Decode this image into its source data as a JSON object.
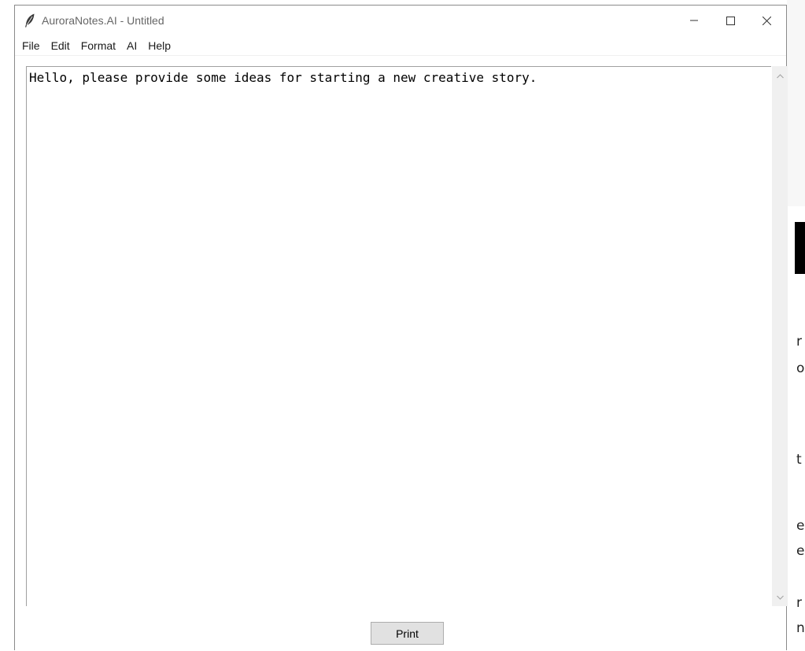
{
  "window": {
    "title": "AuroraNotes.AI - Untitled"
  },
  "menubar": {
    "items": [
      "File",
      "Edit",
      "Format",
      "AI",
      "Help"
    ]
  },
  "editor": {
    "content": "Hello, please provide some ideas for starting a new creative story."
  },
  "bottom": {
    "print_label": "Print"
  },
  "background_window": {
    "fragments": [
      "r",
      "o:",
      "t",
      "e",
      "e",
      "r",
      "n"
    ]
  },
  "icons": {
    "app": "feather-icon",
    "minimize": "minimize-icon",
    "maximize": "maximize-icon",
    "close": "close-icon",
    "scroll_up": "chevron-up-icon",
    "scroll_down": "chevron-down-icon"
  }
}
